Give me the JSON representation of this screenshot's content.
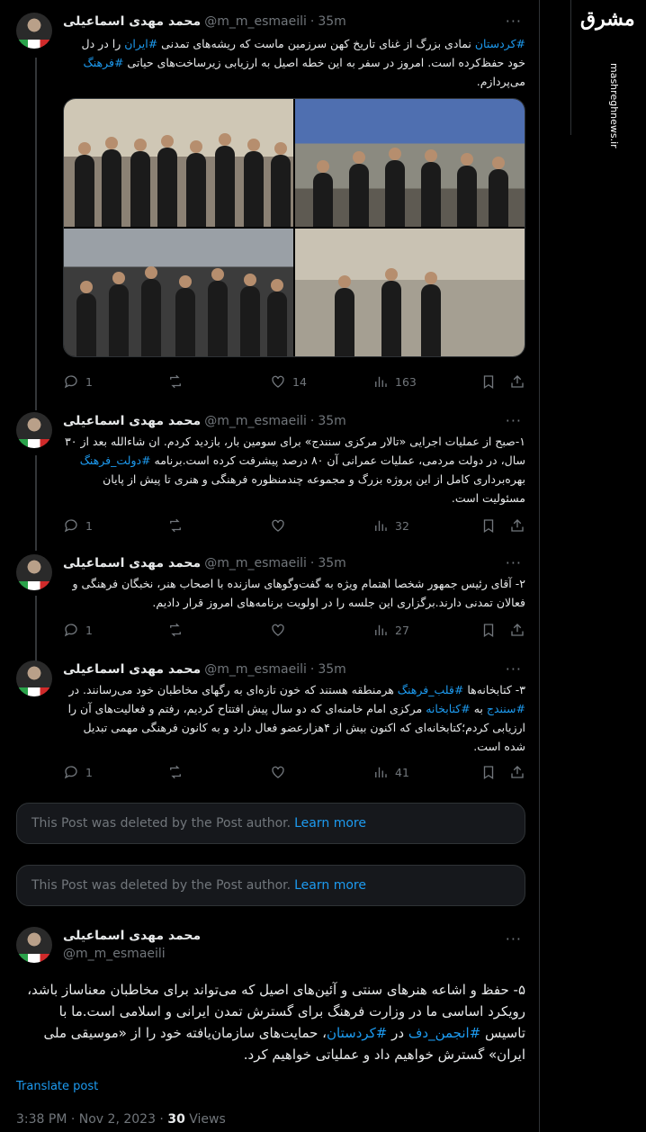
{
  "author": {
    "name": "محمد مهدی اسماعیلی",
    "handle": "@m_m_esmaeili",
    "age": "35m",
    "sep": "·"
  },
  "watermark": {
    "logo_text": "مشرق",
    "url": "mashreghnews.ir"
  },
  "tweets": [
    {
      "text_a": "#کردستان",
      "text_b": " نمادی بزرگ از غنای تاریخ کهن سرزمین ماست که ریشه‌های تمدنی ",
      "text_c": "#ایران",
      "text_d": " را در دل خود حفظ‌کرده است. امروز در سفر به این خطه اصیل به ارزیابی زیرساخت‌های حیاتی ",
      "text_e": "#فرهنگ",
      "text_f": " می‌پردازم.",
      "replies": "1",
      "likes": "14",
      "views": "163"
    },
    {
      "text_a": "۱-صبح از عملیات اجرایی «تالار مرکزی سنندج» برای سومین بار، بازدید کردم. ان شاءالله بعد از ۳۰ سال، در دولت مردمی، عملیات عمرانی آن ۸۰ درصد پیشرفت کرده است.برنامه ",
      "text_b": "#دولت_فرهنگ",
      "text_c": " بهره‌برداری کامل از این پروژه بزرگ و مجموعه چندمنظوره فرهنگی و هنری تا پیش از پایان مسئولیت است.",
      "replies": "1",
      "views": "32"
    },
    {
      "text_a": "۲- آقای رئیس جمهور شخصا اهتمام ویژه به گفت‌وگوهای سازنده با اصحاب هنر، نخبگان فرهنگی و فعالان تمدنی دارند.برگزاری این جلسه را در اولویت برنامه‌های امروز قرار دادیم.",
      "replies": "1",
      "views": "27"
    },
    {
      "text_a": "۳- کتابخانه‌ها ",
      "text_b": "#قلب_فرهنگ",
      "text_c": " هرمنطقه هستند که خون تازه‌ای به رگهای مخاطبان خود می‌رسانند. در ",
      "text_d": "#سنندج",
      "text_e": " به ",
      "text_f": "#کتابخانه",
      "text_g": " مرکزی امام خامنه‌ای که دو سال پیش افتتاح کردیم، رفتم و فعالیت‌های آن را ارزیابی کردم؛کتابخانه‌ای که اکنون بیش از ۴هزارعضو فعال دارد و به کانون فرهنگی مهمی تبدیل شده است.",
      "replies": "1",
      "views": "41"
    }
  ],
  "deleted_notice": {
    "text": "This Post was deleted by the Post author.",
    "link": "Learn more"
  },
  "main_tweet": {
    "text_a": "۵- حفظ و اشاعه هنرهای سنتی و آئین‌های اصیل که می‌تواند برای مخاطبان معناساز باشد، رویکرد اساسی ما در وزارت فرهنگ برای گسترش تمدن ایرانی و اسلامی است.ما با تاسیس ",
    "text_b": "#انجمن_دف",
    "text_c": " در ",
    "text_d": "#کردستان",
    "text_e": "، حمایت‌های سازمان‌یافته خود را از «موسیقی ملی ایران» گسترش خواهیم داد و عملیاتی خواهیم کرد.",
    "translate": "Translate post",
    "time": "3:38 PM · Nov 2, 2023 · ",
    "views_count": "30",
    "views_label": " Views"
  },
  "colors": {
    "background": "#000000",
    "text": "#e7e9ea",
    "muted": "#71767b",
    "accent": "#1d9bf0",
    "border": "#2f3336"
  },
  "icons": [
    "reply-icon",
    "retweet-icon",
    "like-icon",
    "views-icon",
    "bookmark-icon",
    "share-icon",
    "more-icon"
  ]
}
